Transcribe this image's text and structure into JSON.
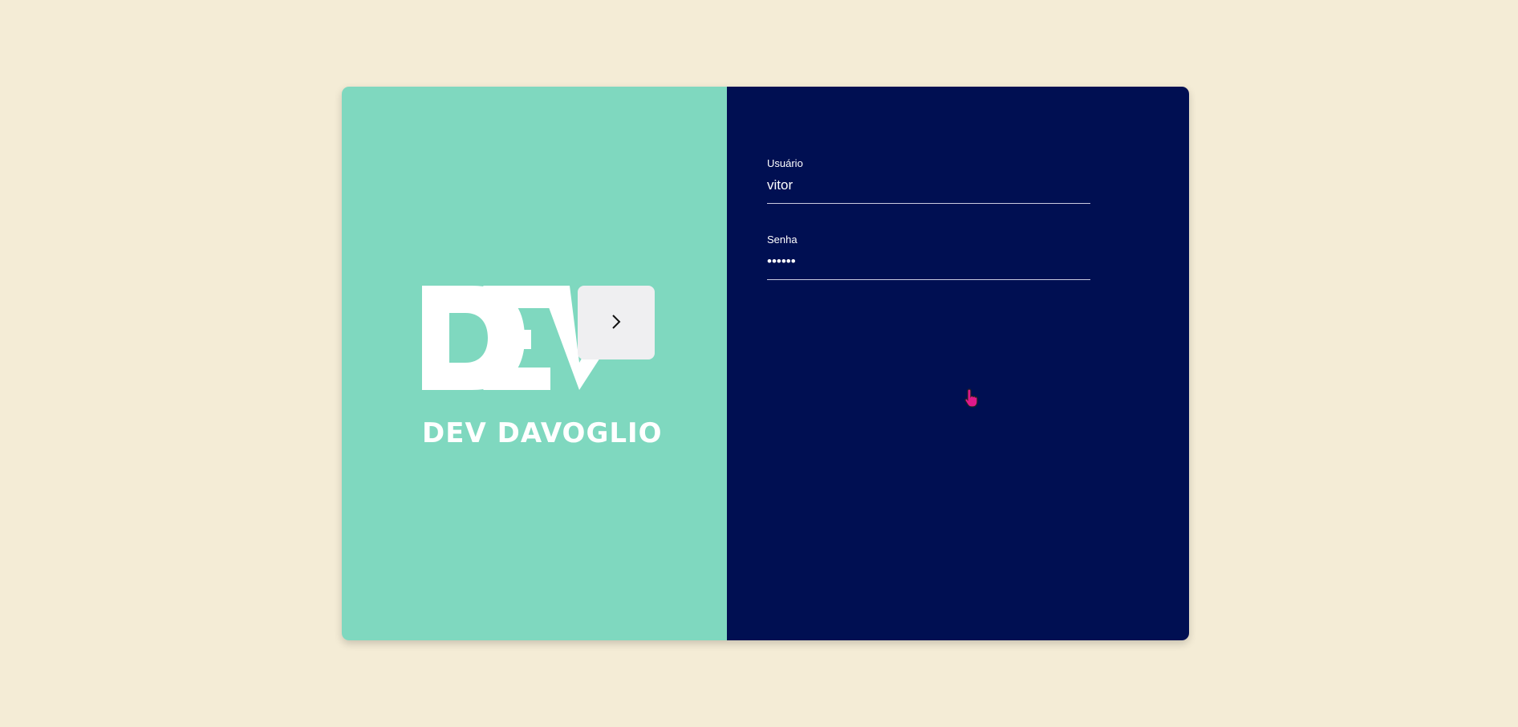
{
  "brand": {
    "logo_text": "DEV",
    "name": "DEV DAVOGLIO"
  },
  "login_form": {
    "username": {
      "label": "Usuário",
      "value": "vitor"
    },
    "password": {
      "label": "Senha",
      "value": "••••••"
    },
    "submit": {
      "icon": "chevron-right-icon"
    }
  },
  "colors": {
    "page_background": "#f4ecd6",
    "left_panel": "#7fd8bf",
    "right_panel": "#000f52",
    "button": "#efeff1",
    "cursor": "#e0198a"
  }
}
